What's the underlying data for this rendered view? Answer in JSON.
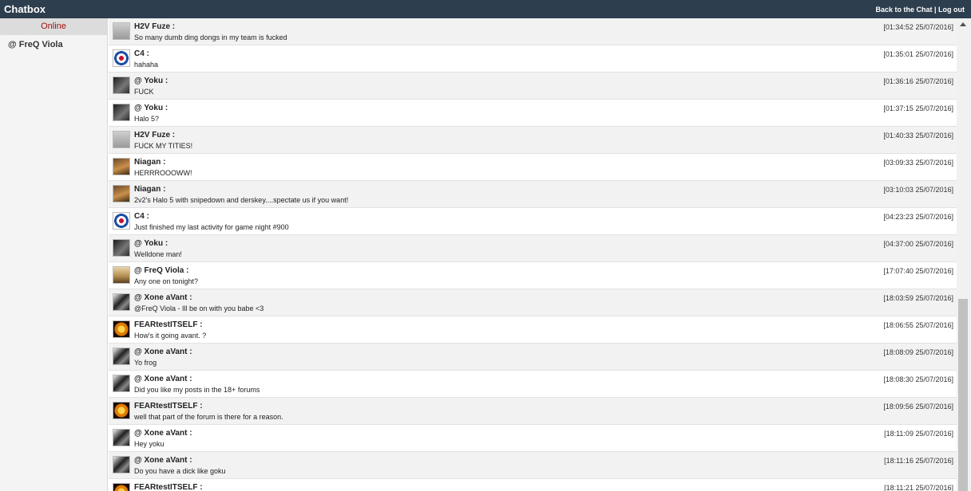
{
  "app": {
    "title": "Chatbox"
  },
  "header": {
    "back_link": "Back to the Chat",
    "separator": " | ",
    "logout_link": "Log out"
  },
  "sidebar": {
    "online_label": "Online",
    "users": [
      "@ FreQ Viola"
    ]
  },
  "messages": [
    {
      "author": "H2V Fuze :",
      "text": "So many dumb ding dongs in my team is fucked",
      "time": "[01:34:52 25/07/2016]",
      "avatar": "grey-avatar-icon"
    },
    {
      "author": "C4 :",
      "text": "hahaha",
      "time": "[01:35:01 25/07/2016]",
      "avatar": "logo-avatar-icon"
    },
    {
      "author": "@ Yoku :",
      "text": "FUCK",
      "time": "[01:36:16 25/07/2016]",
      "avatar": "dark-avatar-icon"
    },
    {
      "author": "@ Yoku :",
      "text": "Halo 5?",
      "time": "[01:37:15 25/07/2016]",
      "avatar": "dark-avatar-icon"
    },
    {
      "author": "H2V Fuze :",
      "text": "FUCK MY TITIES!",
      "time": "[01:40:33 25/07/2016]",
      "avatar": "grey-avatar-icon"
    },
    {
      "author": "Niagan :",
      "text": "HERRROOOWW!",
      "time": "[03:09:33 25/07/2016]",
      "avatar": "brown-avatar-icon"
    },
    {
      "author": "Niagan :",
      "text": "2v2's Halo 5 with snipedown and derskey....spectate us if you want!",
      "time": "[03:10:03 25/07/2016]",
      "avatar": "brown-avatar-icon"
    },
    {
      "author": "C4 :",
      "text": "Just finished my last activity for game night #900",
      "time": "[04:23:23 25/07/2016]",
      "avatar": "logo-avatar-icon"
    },
    {
      "author": "@ Yoku :",
      "text": "Welldone man!",
      "time": "[04:37:00 25/07/2016]",
      "avatar": "dark-avatar-icon"
    },
    {
      "author": "@ FreQ Viola :",
      "text": "Any one on tonight?",
      "time": "[17:07:40 25/07/2016]",
      "avatar": "photo-avatar-icon"
    },
    {
      "author": "@ Xone aVant :",
      "text": "@FreQ Viola - Ill be on with you babe <3",
      "time": "[18:03:59 25/07/2016]",
      "avatar": "bw-avatar-icon"
    },
    {
      "author": "FEARtestITSELF :",
      "text": "How's it going avant. ?",
      "time": "[18:06:55 25/07/2016]",
      "avatar": "orange-avatar-icon"
    },
    {
      "author": "@ Xone aVant :",
      "text": "Yo frog",
      "time": "[18:08:09 25/07/2016]",
      "avatar": "bw-avatar-icon"
    },
    {
      "author": "@ Xone aVant :",
      "text": "Did you like my posts in the 18+ forums",
      "time": "[18:08:30 25/07/2016]",
      "avatar": "bw-avatar-icon"
    },
    {
      "author": "FEARtestITSELF :",
      "text": "well that part of the forum is there for a reason.",
      "time": "[18:09:56 25/07/2016]",
      "avatar": "orange-avatar-icon"
    },
    {
      "author": "@ Xone aVant :",
      "text": "Hey yoku",
      "time": "[18:11:09 25/07/2016]",
      "avatar": "bw-avatar-icon"
    },
    {
      "author": "@ Xone aVant :",
      "text": "Do you have a dick like goku",
      "time": "[18:11:16 25/07/2016]",
      "avatar": "bw-avatar-icon"
    },
    {
      "author": "FEARtestITSELF :",
      "text": "",
      "time": "[18:11:21 25/07/2016]",
      "avatar": "orange-avatar-icon"
    }
  ]
}
